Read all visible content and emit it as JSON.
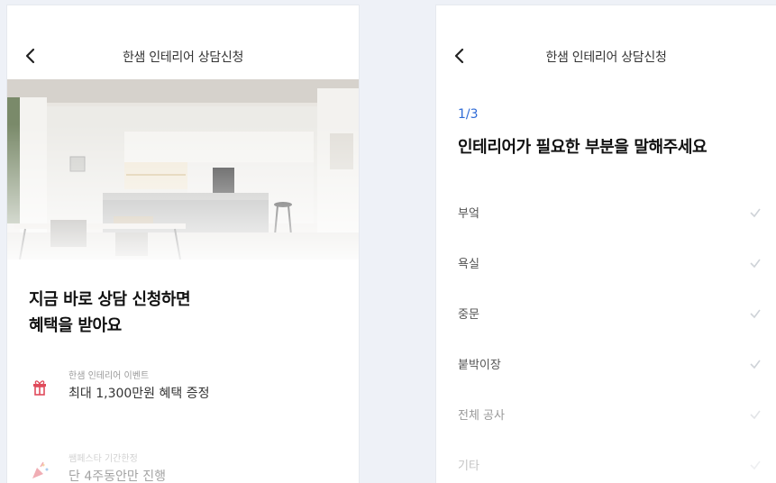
{
  "left": {
    "header_title": "한샘 인테리어 상담신청",
    "headline_line1": "지금 바로 상담 신청하면",
    "headline_line2": "혜택을 받아요",
    "benefits": [
      {
        "icon": "gift-icon",
        "caption": "한샘 인테리어 이벤트",
        "text": "최대 1,300만원 혜택 증정"
      },
      {
        "icon": "party-popper-icon",
        "caption": "쌤페스타 기간한정",
        "text": "단 4주동안만 진행"
      }
    ]
  },
  "right": {
    "header_title": "한샘 인테리어 상담신청",
    "step": "1/3",
    "question": "인테리어가 필요한 부분을 말해주세요",
    "options": [
      "부엌",
      "욕실",
      "중문",
      "붙박이장",
      "전체 공사",
      "기타"
    ]
  },
  "colors": {
    "accent": "#2f6bd6",
    "gift": "#e04b5b"
  }
}
